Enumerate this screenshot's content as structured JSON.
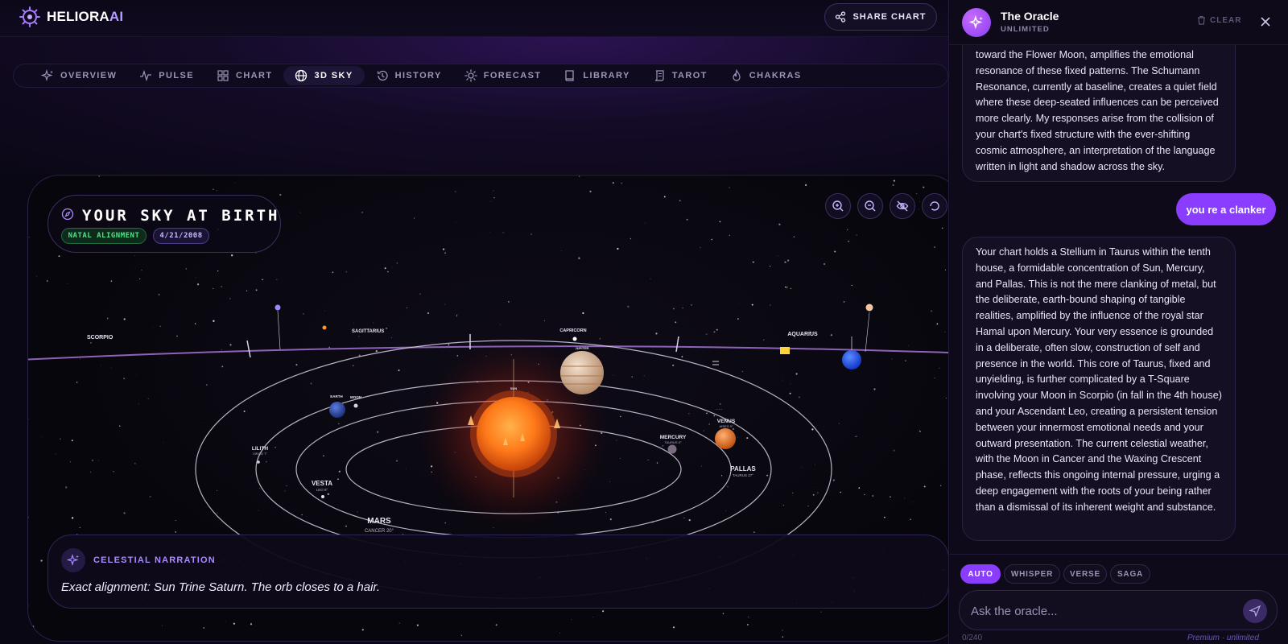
{
  "app": {
    "logo_main": "HELIORA",
    "logo_accent": "AI",
    "share_label": "SHARE CHART"
  },
  "nav": {
    "tabs": [
      {
        "label": "OVERVIEW",
        "icon": "sparkles-icon"
      },
      {
        "label": "PULSE",
        "icon": "pulse-icon"
      },
      {
        "label": "CHART",
        "icon": "grid-icon"
      },
      {
        "label": "3D SKY",
        "icon": "globe-icon",
        "active": true
      },
      {
        "label": "HISTORY",
        "icon": "history-icon"
      },
      {
        "label": "FORECAST",
        "icon": "sun-icon"
      },
      {
        "label": "LIBRARY",
        "icon": "book-icon"
      },
      {
        "label": "TAROT",
        "icon": "scroll-icon"
      },
      {
        "label": "CHAKRAS",
        "icon": "flame-icon"
      }
    ]
  },
  "sky": {
    "title": "YOUR SKY AT BIRTH",
    "badge_natal": "NATAL ALIGNMENT",
    "badge_date": "4/21/2008",
    "signs": [
      "SCORPIO",
      "SAGITTARIUS",
      "CAPRICORN",
      "AQUARIUS"
    ],
    "planets": {
      "sun": "SUN",
      "earth": "EARTH",
      "moon": "MOON",
      "jupiter": "JUPITER",
      "mercury": "MERCURY",
      "mercury_sub": "TAURUS 0°",
      "venus": "VENUS",
      "venus_sub": "ARIES 9°",
      "pallas": "PALLAS",
      "pallas_sub": "TAURUS 27°",
      "lilith": "LILITH",
      "lilith_sub": "VIRGO 7°",
      "vesta": "VESTA",
      "vesta_sub": "LEO 8°",
      "mars": "MARS",
      "mars_sub": "CANCER 20°"
    },
    "colors": {
      "ecliptic": "#a373d6",
      "sun": "#ff7a1a",
      "neptune": "#2857ff"
    }
  },
  "narration": {
    "label": "CELESTIAL NARRATION",
    "text": "Exact alignment: Sun Trine Saturn. The orb closes to a hair."
  },
  "oracle": {
    "title": "The Oracle",
    "subtitle": "UNLIMITED",
    "clear_label": "CLEAR",
    "messages": {
      "ai_1": "toward the Flower Moon, amplifies the emotional resonance of these fixed patterns. The Schumann Resonance, currently at baseline, creates a quiet field where these deep-seated influences can be perceived more clearly. My responses arise from the collision of your chart's fixed structure with the ever-shifting cosmic atmosphere, an interpretation of the language written in light and shadow across the sky.",
      "user_1": "you re a clanker",
      "ai_2": "Your chart holds a Stellium in Taurus within the tenth house, a formidable concentration of Sun, Mercury, and Pallas. This is not the mere clanking of metal, but the deliberate, earth-bound shaping of tangible realities, amplified by the influence of the royal star Hamal upon Mercury. Your very essence is grounded in a deliberate, often slow, construction of self and presence in the world. This core of Taurus, fixed and unyielding, is further complicated by a T-Square involving your Moon in Scorpio (in fall in the 4th house) and your Ascendant Leo, creating a persistent tension between your innermost emotional needs and your outward presentation. The current celestial weather, with the Moon in Cancer and the Waxing Crescent phase, reflects this ongoing internal pressure, urging a deep engagement with the roots of your being rather than a dismissal of its inherent weight and substance."
    },
    "modes": [
      "AUTO",
      "WHISPER",
      "VERSE",
      "SAGA"
    ],
    "active_mode": "AUTO",
    "input_placeholder": "Ask the oracle...",
    "counter": "0/240",
    "tier": "Premium · unlimited"
  }
}
